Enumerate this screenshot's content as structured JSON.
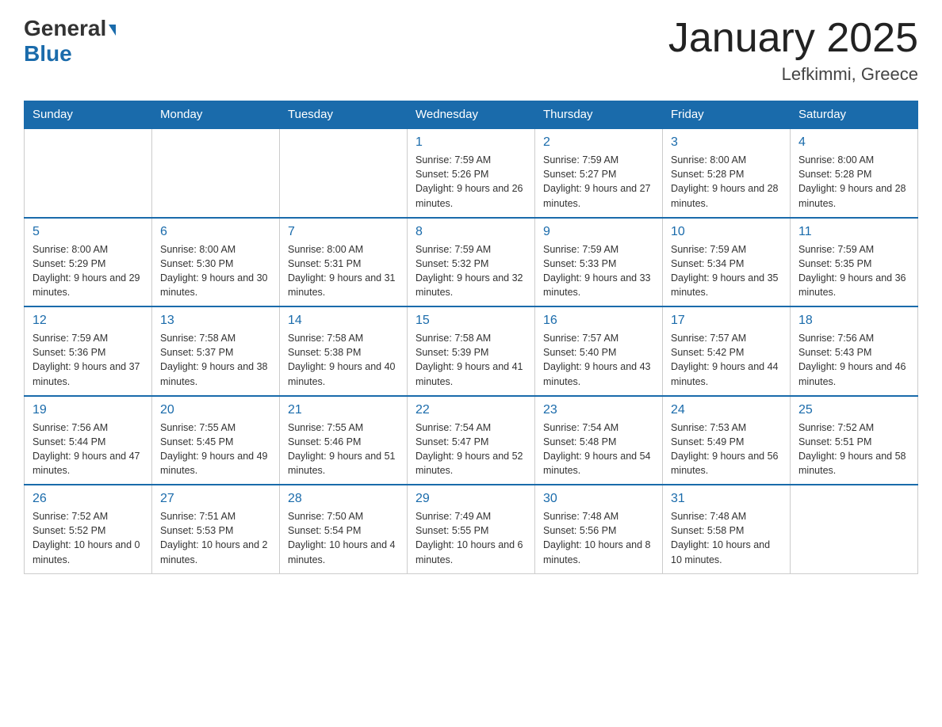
{
  "header": {
    "logo": {
      "line1": "General",
      "triangle": "▶",
      "line2": "Blue"
    },
    "title": "January 2025",
    "location": "Lefkimmi, Greece"
  },
  "days": [
    "Sunday",
    "Monday",
    "Tuesday",
    "Wednesday",
    "Thursday",
    "Friday",
    "Saturday"
  ],
  "weeks": [
    [
      {
        "day": "",
        "info": ""
      },
      {
        "day": "",
        "info": ""
      },
      {
        "day": "",
        "info": ""
      },
      {
        "day": "1",
        "info": "Sunrise: 7:59 AM\nSunset: 5:26 PM\nDaylight: 9 hours and 26 minutes."
      },
      {
        "day": "2",
        "info": "Sunrise: 7:59 AM\nSunset: 5:27 PM\nDaylight: 9 hours and 27 minutes."
      },
      {
        "day": "3",
        "info": "Sunrise: 8:00 AM\nSunset: 5:28 PM\nDaylight: 9 hours and 28 minutes."
      },
      {
        "day": "4",
        "info": "Sunrise: 8:00 AM\nSunset: 5:28 PM\nDaylight: 9 hours and 28 minutes."
      }
    ],
    [
      {
        "day": "5",
        "info": "Sunrise: 8:00 AM\nSunset: 5:29 PM\nDaylight: 9 hours and 29 minutes."
      },
      {
        "day": "6",
        "info": "Sunrise: 8:00 AM\nSunset: 5:30 PM\nDaylight: 9 hours and 30 minutes."
      },
      {
        "day": "7",
        "info": "Sunrise: 8:00 AM\nSunset: 5:31 PM\nDaylight: 9 hours and 31 minutes."
      },
      {
        "day": "8",
        "info": "Sunrise: 7:59 AM\nSunset: 5:32 PM\nDaylight: 9 hours and 32 minutes."
      },
      {
        "day": "9",
        "info": "Sunrise: 7:59 AM\nSunset: 5:33 PM\nDaylight: 9 hours and 33 minutes."
      },
      {
        "day": "10",
        "info": "Sunrise: 7:59 AM\nSunset: 5:34 PM\nDaylight: 9 hours and 35 minutes."
      },
      {
        "day": "11",
        "info": "Sunrise: 7:59 AM\nSunset: 5:35 PM\nDaylight: 9 hours and 36 minutes."
      }
    ],
    [
      {
        "day": "12",
        "info": "Sunrise: 7:59 AM\nSunset: 5:36 PM\nDaylight: 9 hours and 37 minutes."
      },
      {
        "day": "13",
        "info": "Sunrise: 7:58 AM\nSunset: 5:37 PM\nDaylight: 9 hours and 38 minutes."
      },
      {
        "day": "14",
        "info": "Sunrise: 7:58 AM\nSunset: 5:38 PM\nDaylight: 9 hours and 40 minutes."
      },
      {
        "day": "15",
        "info": "Sunrise: 7:58 AM\nSunset: 5:39 PM\nDaylight: 9 hours and 41 minutes."
      },
      {
        "day": "16",
        "info": "Sunrise: 7:57 AM\nSunset: 5:40 PM\nDaylight: 9 hours and 43 minutes."
      },
      {
        "day": "17",
        "info": "Sunrise: 7:57 AM\nSunset: 5:42 PM\nDaylight: 9 hours and 44 minutes."
      },
      {
        "day": "18",
        "info": "Sunrise: 7:56 AM\nSunset: 5:43 PM\nDaylight: 9 hours and 46 minutes."
      }
    ],
    [
      {
        "day": "19",
        "info": "Sunrise: 7:56 AM\nSunset: 5:44 PM\nDaylight: 9 hours and 47 minutes."
      },
      {
        "day": "20",
        "info": "Sunrise: 7:55 AM\nSunset: 5:45 PM\nDaylight: 9 hours and 49 minutes."
      },
      {
        "day": "21",
        "info": "Sunrise: 7:55 AM\nSunset: 5:46 PM\nDaylight: 9 hours and 51 minutes."
      },
      {
        "day": "22",
        "info": "Sunrise: 7:54 AM\nSunset: 5:47 PM\nDaylight: 9 hours and 52 minutes."
      },
      {
        "day": "23",
        "info": "Sunrise: 7:54 AM\nSunset: 5:48 PM\nDaylight: 9 hours and 54 minutes."
      },
      {
        "day": "24",
        "info": "Sunrise: 7:53 AM\nSunset: 5:49 PM\nDaylight: 9 hours and 56 minutes."
      },
      {
        "day": "25",
        "info": "Sunrise: 7:52 AM\nSunset: 5:51 PM\nDaylight: 9 hours and 58 minutes."
      }
    ],
    [
      {
        "day": "26",
        "info": "Sunrise: 7:52 AM\nSunset: 5:52 PM\nDaylight: 10 hours and 0 minutes."
      },
      {
        "day": "27",
        "info": "Sunrise: 7:51 AM\nSunset: 5:53 PM\nDaylight: 10 hours and 2 minutes."
      },
      {
        "day": "28",
        "info": "Sunrise: 7:50 AM\nSunset: 5:54 PM\nDaylight: 10 hours and 4 minutes."
      },
      {
        "day": "29",
        "info": "Sunrise: 7:49 AM\nSunset: 5:55 PM\nDaylight: 10 hours and 6 minutes."
      },
      {
        "day": "30",
        "info": "Sunrise: 7:48 AM\nSunset: 5:56 PM\nDaylight: 10 hours and 8 minutes."
      },
      {
        "day": "31",
        "info": "Sunrise: 7:48 AM\nSunset: 5:58 PM\nDaylight: 10 hours and 10 minutes."
      },
      {
        "day": "",
        "info": ""
      }
    ]
  ],
  "colors": {
    "header_bg": "#1a6bab",
    "accent_blue": "#1a6bab"
  }
}
